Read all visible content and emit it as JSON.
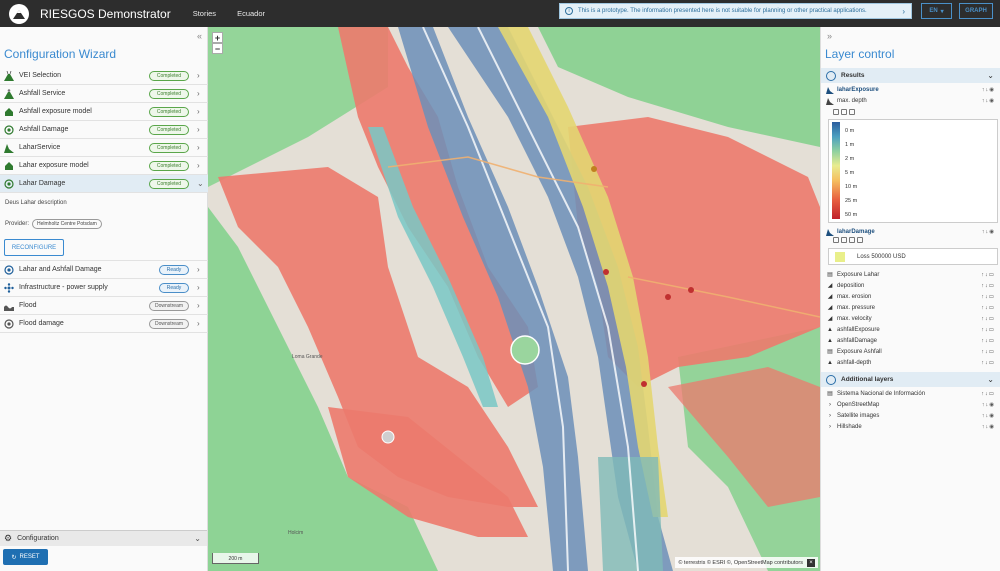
{
  "app": {
    "title": "RIESGOS Demonstrator",
    "nav": [
      "Stories",
      "Ecuador"
    ],
    "banner": "This is a prototype. The information presented here is not suitable for planning or other practical applications.",
    "lang_label": "EN",
    "graph_label": "GRAPH"
  },
  "wizard": {
    "title": "Configuration Wizard",
    "steps": [
      {
        "label": "VEI Selection",
        "status": "Completed",
        "status_kind": "completed",
        "icon": "volcano-icon"
      },
      {
        "label": "Ashfall Service",
        "status": "Completed",
        "status_kind": "completed",
        "icon": "volcano-icon"
      },
      {
        "label": "Ashfall exposure model",
        "status": "Completed",
        "status_kind": "completed",
        "icon": "house-icon"
      },
      {
        "label": "Ashfall Damage",
        "status": "Completed",
        "status_kind": "completed",
        "icon": "target-icon"
      },
      {
        "label": "LaharService",
        "status": "Completed",
        "status_kind": "completed",
        "icon": "lahar-icon"
      },
      {
        "label": "Lahar exposure model",
        "status": "Completed",
        "status_kind": "completed",
        "icon": "house-icon"
      },
      {
        "label": "Lahar Damage",
        "status": "Completed",
        "status_kind": "completed",
        "icon": "target-icon"
      }
    ],
    "active_step": {
      "description": "Deus Lahar description",
      "provider_label": "Provider:",
      "provider": "Helmholtz Centre Potsdam",
      "reconfigure": "RECONFIGURE"
    },
    "later_steps": [
      {
        "label": "Lahar and Ashfall Damage",
        "status": "Ready",
        "status_kind": "ready",
        "icon": "target-icon"
      },
      {
        "label": "Infrastructure - power supply",
        "status": "Ready",
        "status_kind": "ready",
        "icon": "network-icon"
      },
      {
        "label": "Flood",
        "status": "Downstream",
        "status_kind": "downstream",
        "icon": "wave-icon"
      },
      {
        "label": "Flood damage",
        "status": "Downstream",
        "status_kind": "downstream",
        "icon": "target-icon"
      }
    ],
    "configuration_label": "Configuration",
    "reset_label": "RESET"
  },
  "map": {
    "zoom_in": "+",
    "zoom_out": "−",
    "scale": "200 m",
    "attribution": "© terrestris © ESRI ©, OpenStreetMap contributors",
    "place_label_1": "Loma Grande",
    "place_label_2": "Holcim"
  },
  "layers": {
    "title": "Layer control",
    "results_label": "Results",
    "lahar_exposure": "laharExposure",
    "max_depth": "max. depth",
    "legend": [
      "0 m",
      "1 m",
      "2 m",
      "5 m",
      "10 m",
      "25 m",
      "50 m"
    ],
    "lahar_damage": "laharDamage",
    "loss_label": "Loss 500000 USD",
    "other_results": [
      "Exposure Lahar",
      "deposition",
      "max. erosion",
      "max. pressure",
      "max. velocity",
      "ashfallExposure",
      "ashfallDamage",
      "Exposure Ashfall",
      "ashfall-depth"
    ],
    "additional_label": "Additional layers",
    "additional": [
      "Sistema Nacional de Información",
      "OpenStreetMap",
      "Satellite images",
      "Hillshade"
    ]
  }
}
